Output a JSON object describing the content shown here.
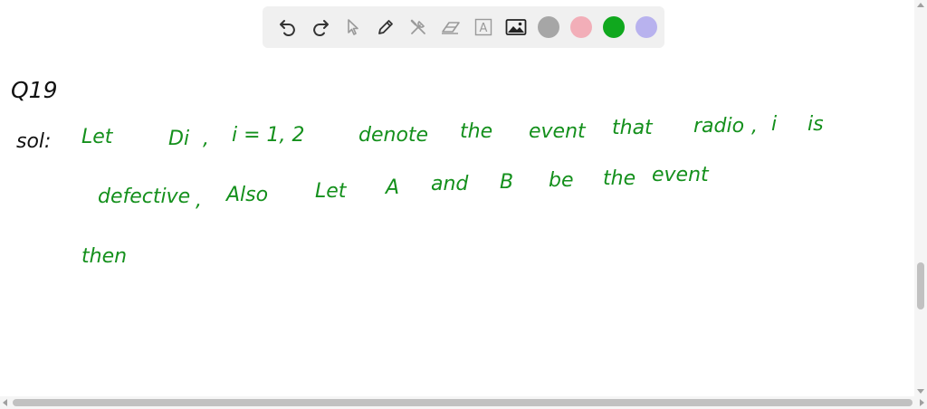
{
  "toolbar": {
    "tools": [
      {
        "name": "undo-icon",
        "active": true
      },
      {
        "name": "redo-icon",
        "active": true
      },
      {
        "name": "select-pointer-icon",
        "active": false
      },
      {
        "name": "pencil-icon",
        "active": true
      },
      {
        "name": "tools-icon",
        "active": false
      },
      {
        "name": "eraser-icon",
        "active": false
      },
      {
        "name": "text-box-icon",
        "active": false
      },
      {
        "name": "image-icon",
        "active": true
      }
    ],
    "text_tool_glyph": "A",
    "colors": [
      {
        "name": "gray",
        "hex": "#a6a6a6"
      },
      {
        "name": "pink",
        "hex": "#f2aeb8"
      },
      {
        "name": "green",
        "hex": "#10a81e",
        "selected": true
      },
      {
        "name": "lavender",
        "hex": "#b8b2ee"
      }
    ]
  },
  "notes": {
    "ink_colors": {
      "black": "#111111",
      "green": "#14901c"
    },
    "question_label": "Q19",
    "solution_label": "sol:",
    "line1": [
      "Let",
      "Di",
      ",",
      "i = 1, 2",
      "denote",
      "the",
      "event",
      "that",
      "radio",
      ",",
      "i",
      "is"
    ],
    "line2": [
      "defective",
      ",",
      "Also",
      "Let",
      "A",
      "and",
      "B",
      "be",
      "the",
      "event"
    ],
    "line3": [
      "then"
    ]
  }
}
